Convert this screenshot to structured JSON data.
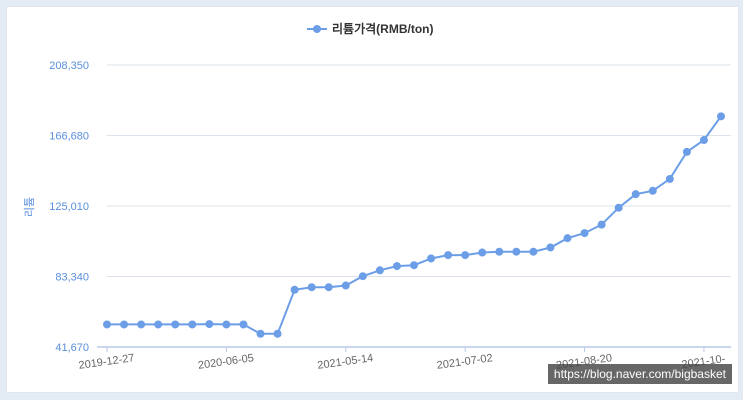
{
  "chart_data": {
    "type": "line",
    "legend": {
      "label": "리튬가격(RMB/ton)",
      "position": "top-center"
    },
    "ylabel": "리튬",
    "ylim": [
      41670,
      208350
    ],
    "yticks": [
      "41,670",
      "83,340",
      "125,010",
      "166,680",
      "208,350"
    ],
    "xtick_labels": [
      "2019-12-27",
      "2020-06-05",
      "2021-05-14",
      "2021-07-02",
      "2021-08-20",
      "2021-10-"
    ],
    "grid": "horizontal",
    "series": [
      {
        "name": "리튬가격(RMB/ton)",
        "color": "#6c9ee8",
        "values": [
          55000,
          55000,
          55000,
          55000,
          55000,
          55000,
          55200,
          55000,
          55000,
          49500,
          49500,
          75500,
          77000,
          77000,
          78000,
          83500,
          87000,
          89500,
          90000,
          94000,
          96000,
          96000,
          97500,
          98000,
          98000,
          98000,
          100500,
          106000,
          109000,
          114000,
          124000,
          132000,
          134000,
          141000,
          157000,
          164000,
          178000
        ]
      }
    ]
  },
  "watermark": "https://blog.naver.com/bigbasket"
}
